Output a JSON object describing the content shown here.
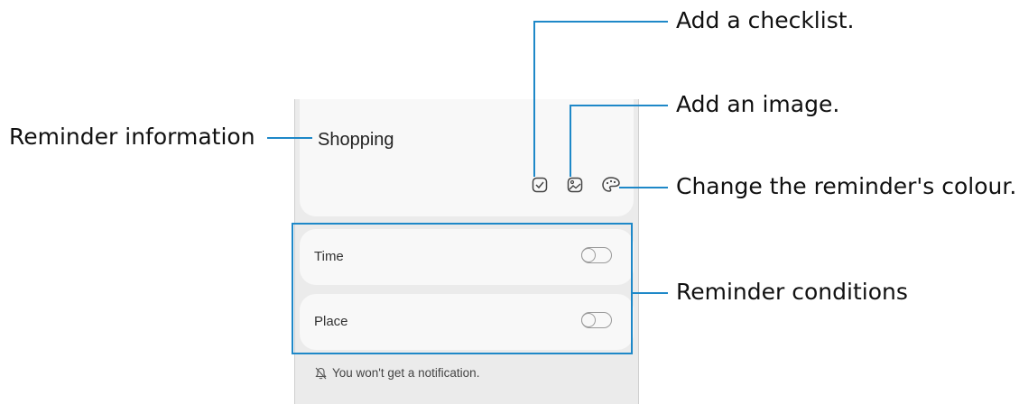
{
  "reminder": {
    "title": "Shopping",
    "conditions": [
      {
        "label": "Time",
        "toggle_on": false
      },
      {
        "label": "Place",
        "toggle_on": false
      }
    ],
    "notice": "You won't get a notification."
  },
  "icons": {
    "checklist": "checkbox-icon",
    "image": "image-icon",
    "colour": "palette-icon",
    "notice": "bell-off-icon"
  },
  "callouts": {
    "checklist": "Add a checklist.",
    "image": "Add an image.",
    "colour": "Change the reminder's colour.",
    "info": "Reminder information",
    "conditions": "Reminder conditions"
  },
  "colors": {
    "callout_line": "#1e88c8",
    "screen_bg": "#ebebeb",
    "card_bg": "#f8f8f8"
  }
}
